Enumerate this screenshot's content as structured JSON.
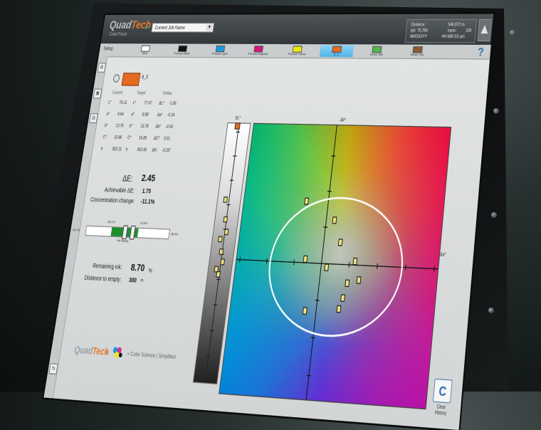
{
  "app": {
    "brand_left": "Quad",
    "brand_right": "Tech",
    "product": "ColorTrack",
    "job_select": "Current Job Name",
    "info": {
      "distance_label": "Distance:",
      "distance_value": "546,872 m",
      "iph_label": "iph: 75,789",
      "mpm_label": "mpm:",
      "mpm_value": "100",
      "date_label": "MM/DD/YY",
      "time_label": "HH:MM:SS pm"
    }
  },
  "inks": {
    "setup_label": "Setup",
    "items": [
      {
        "label": "Nme",
        "color": "#ffffff"
      },
      {
        "label": "Process Black",
        "color": "#111111"
      },
      {
        "label": "Process Cyan",
        "color": "#1a9be0"
      },
      {
        "label": "Process Magenta",
        "color": "#d8157f"
      },
      {
        "label": "Process Yellow",
        "color": "#f0ec00"
      },
      {
        "label": "8_3",
        "color": "#e36b1f",
        "selected": true
      },
      {
        "label": "Green 366",
        "color": "#52b84c"
      },
      {
        "label": "Brown 464",
        "color": "#8a5a36"
      }
    ],
    "help": "?"
  },
  "left_icons": [
    {
      "name": "overview",
      "glyph": "⊞",
      "label": "Press Overview"
    },
    {
      "name": "target",
      "glyph": "▣",
      "label": "Target"
    },
    {
      "name": "tools",
      "glyph": "▤",
      "label": "Tools"
    }
  ],
  "left_icons_bottom": {
    "glyph": "⇆",
    "label": "Compare Prints"
  },
  "selected": {
    "name": "8_3",
    "headers": {
      "current": "Current",
      "target": "Target",
      "deltas": "Deltas"
    },
    "current": [
      {
        "k": "L*",
        "v": "76.11"
      },
      {
        "k": "a*",
        "v": "8.64"
      },
      {
        "k": "b*",
        "v": "13.75"
      },
      {
        "k": "C*",
        "v": "15.86"
      },
      {
        "k": "h",
        "v": "302.21"
      }
    ],
    "target": [
      {
        "k": "L*",
        "v": "77.67"
      },
      {
        "k": "a*",
        "v": "8.88"
      },
      {
        "k": "b*",
        "v": "13.78"
      },
      {
        "k": "C*",
        "v": "15.85"
      },
      {
        "k": "h",
        "v": "302.45"
      }
    ],
    "deltas": [
      {
        "k": "ΔL*",
        "v": "-1.56"
      },
      {
        "k": "Δa*",
        "v": "-0.24"
      },
      {
        "k": "Δb*",
        "v": "-0.03"
      },
      {
        "k": "ΔC*",
        "v": "0.01"
      },
      {
        "k": "ΔH",
        "v": "-0.23°"
      }
    ]
  },
  "metrics": {
    "de_label": "ΔE:",
    "de_value": "2.45",
    "ach_label": "Achievable ΔE:",
    "ach_value": "1.75",
    "conc_label": "Concentration change:",
    "conc_value": "-11.1%",
    "zone_left_top": "-36.1%",
    "zone_right_top": "13.9%",
    "zone_left": "-92.1%",
    "zone_right": "38.9%",
    "zone_caption": "Ink Ready",
    "remaining_label": "Remaining ink:",
    "remaining_value": "8.70",
    "remaining_unit": "kg",
    "empty_label": "Distance to empty:",
    "empty_value": "300",
    "empty_unit": "m"
  },
  "footer": {
    "brand_left": "Quad",
    "brand_right": "Tech",
    "plus": "+",
    "tagline": "= Color Science | Simplified"
  },
  "plot": {
    "db_label": "Δb*",
    "da_label": "Δa*",
    "dl_label": "ΔL*",
    "points": [
      {
        "da": -0.8,
        "db": 1.7
      },
      {
        "da": 0.3,
        "db": 1.2
      },
      {
        "da": 0.6,
        "db": 0.6
      },
      {
        "da": -0.6,
        "db": 0.1
      },
      {
        "da": 0.2,
        "db": -0.1
      },
      {
        "da": 1.0,
        "db": -0.5
      },
      {
        "da": 0.9,
        "db": -0.9
      },
      {
        "da": 1.4,
        "db": -0.4
      },
      {
        "da": 1.2,
        "db": 0.1
      },
      {
        "da": -0.4,
        "db": -1.3
      },
      {
        "da": 0.8,
        "db": -1.2
      }
    ],
    "l_points": [
      {
        "dl": 2.2
      },
      {
        "dl": 1.4
      },
      {
        "dl": 0.9
      },
      {
        "dl": 0.6
      },
      {
        "dl": 0.1
      },
      {
        "dl": -0.3
      },
      {
        "dl": -0.6
      },
      {
        "dl": -0.8
      }
    ],
    "clear_glyph": "C",
    "clear_label": "Clear History"
  }
}
